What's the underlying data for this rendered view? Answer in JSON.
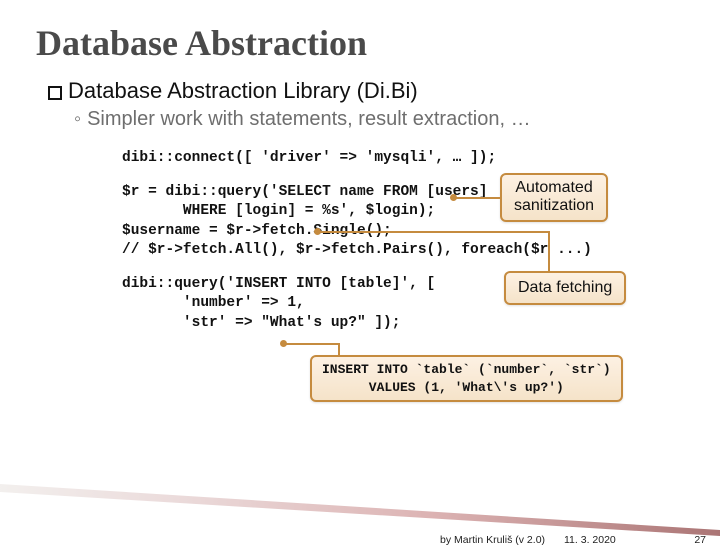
{
  "title": "Database Abstraction",
  "bullet": "Database Abstraction Library (Di.Bi)",
  "sub": "Simpler work with statements, result extraction, …",
  "code": {
    "l1": "dibi::connect([ 'driver' => 'mysqli', … ]);",
    "l2": "$r = dibi::query('SELECT name FROM [users]",
    "l3": "       WHERE [login] = %s', $login);",
    "l4": "$username = $r->fetch.Single();",
    "l5": "// $r->fetch.All(), $r->fetch.Pairs(), foreach($r ...)",
    "l6": "dibi::query('INSERT INTO [table]', [",
    "l7": "       'number' => 1,",
    "l8": "       'str' => \"What's up?\" ]);"
  },
  "callouts": {
    "sanit": "Automated\nsanitization",
    "fetch": "Data fetching",
    "sql": "INSERT INTO `table` (`number`, `str`)\nVALUES (1, 'What\\'s up?')"
  },
  "footer": {
    "author": "by Martin Kruliš (v 2.0)",
    "date": "11. 3. 2020",
    "page": "27"
  }
}
